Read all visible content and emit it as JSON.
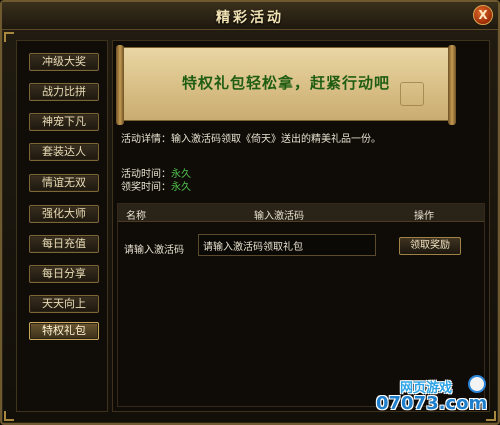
{
  "window": {
    "title": "精彩活动",
    "close_label": "X"
  },
  "sidebar": {
    "items": [
      {
        "label": "冲级大奖",
        "active": false
      },
      {
        "label": "战力比拼",
        "active": false
      },
      {
        "label": "神宠下凡",
        "active": false
      },
      {
        "label": "套装达人",
        "active": false
      },
      {
        "label": "情谊无双",
        "active": false
      },
      {
        "label": "强化大师",
        "active": false
      },
      {
        "label": "每日充值",
        "active": false
      },
      {
        "label": "每日分享",
        "active": false
      },
      {
        "label": "天天向上",
        "active": false
      },
      {
        "label": "特权礼包",
        "active": true
      }
    ]
  },
  "banner": {
    "text": "特权礼包轻松拿，赶紧行动吧"
  },
  "activity": {
    "detail_label": "活动详情：",
    "detail_text": "输入激活码领取《倚天》送出的精美礼品一份。",
    "time_label": "活动时间：",
    "time_value": "永久",
    "claim_time_label": "领奖时间：",
    "claim_time_value": "永久"
  },
  "table": {
    "headers": {
      "name": "名称",
      "code": "输入激活码",
      "action": "操作"
    },
    "row": {
      "label": "请输入激活码",
      "input_value": "请输入激活码领取礼包",
      "button_label": "领取奖励"
    }
  },
  "watermark": {
    "top": "网页游戏",
    "bottom": "07073.com"
  },
  "colors": {
    "accent_gold": "#c9a55a",
    "highlight_green": "#4fc24a",
    "banner_text": "#1f5d12"
  }
}
